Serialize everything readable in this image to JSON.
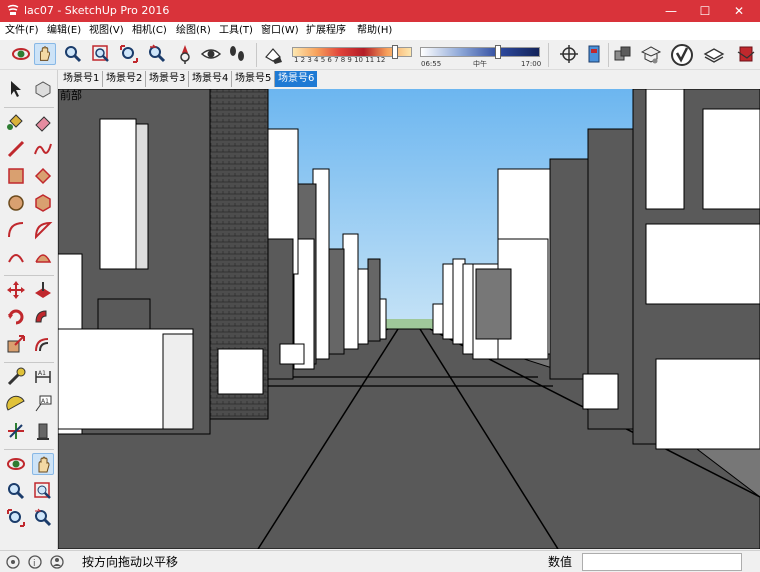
{
  "window": {
    "title": "lac07 - SketchUp Pro 2016",
    "minimize_glyph": "—",
    "maximize_glyph": "☐",
    "close_glyph": "✕"
  },
  "menu": [
    "文件(F)",
    "编辑(E)",
    "视图(V)",
    "相机(C)",
    "绘图(R)",
    "工具(T)",
    "窗口(W)",
    "扩展程序",
    "帮助(H)"
  ],
  "shadow": {
    "month_ticks": "1  2  3  4  5  6  7  8  9  10 11 12",
    "time_start": "06:55",
    "time_mid": "中午",
    "time_end": "17:00"
  },
  "scenes": [
    "场景号1",
    "场景号2",
    "场景号3",
    "场景号4",
    "场景号5",
    "场景号6"
  ],
  "active_scene_index": 5,
  "viewport": {
    "view_name": "前部",
    "sky_top": "#6cb6f0",
    "sky_bottom": "#c6e3f6",
    "ground": "#595959"
  },
  "status": {
    "hint": "按方向拖动以平移",
    "vcb_label": "数值",
    "vcb_value": ""
  },
  "colors": {
    "title_bar": "#d9333a",
    "accent_tab": "#1e7ad4"
  },
  "icons": {
    "left_palette": [
      "select-icon",
      "component-icon",
      "paint-bucket-icon",
      "eraser-icon",
      "line-icon",
      "freehand-icon",
      "rectangle-icon",
      "rotated-rectangle-icon",
      "circle-icon",
      "polygon-icon",
      "arc-icon",
      "pie-icon",
      "two-point-arc-icon",
      "three-point-arc-icon",
      "move-icon",
      "push-pull-icon",
      "rotate-icon",
      "follow-me-icon",
      "scale-icon",
      "offset-icon",
      "tape-measure-icon",
      "dimension-icon",
      "protractor-icon",
      "text-icon",
      "axes-icon",
      "3d-text-icon",
      "orbit-icon",
      "pan-icon",
      "zoom-icon",
      "zoom-window-icon",
      "zoom-extents-icon",
      "previous-view-icon"
    ]
  }
}
